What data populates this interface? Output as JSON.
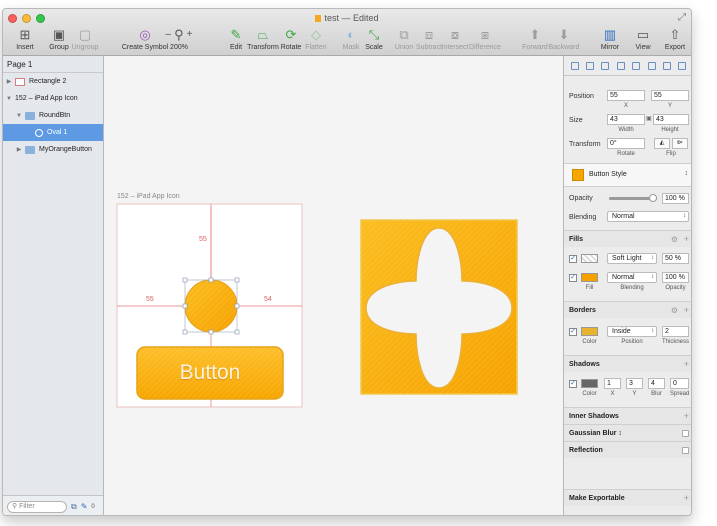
{
  "window": {
    "title": "test",
    "title_suffix": "— Edited"
  },
  "toolbar": {
    "items": [
      {
        "label": "Insert",
        "icon": "insert-icon",
        "enabled": true
      },
      {
        "label": "Group",
        "icon": "group-icon",
        "enabled": true
      },
      {
        "label": "Ungroup",
        "icon": "ungroup-icon",
        "enabled": false
      },
      {
        "label": "Create Symbol",
        "icon": "create-symbol-icon",
        "enabled": true
      },
      {
        "label": "200%",
        "icon": "zoom-icon",
        "enabled": true
      },
      {
        "label": "Edit",
        "icon": "edit-icon",
        "enabled": true
      },
      {
        "label": "Transform",
        "icon": "transform-icon",
        "enabled": true
      },
      {
        "label": "Rotate",
        "icon": "rotate-icon",
        "enabled": true
      },
      {
        "label": "Flatten",
        "icon": "flatten-icon",
        "enabled": false
      },
      {
        "label": "Mask",
        "icon": "mask-icon",
        "enabled": false
      },
      {
        "label": "Scale",
        "icon": "scale-icon",
        "enabled": true
      },
      {
        "label": "Union",
        "icon": "union-icon",
        "enabled": false
      },
      {
        "label": "Subtract",
        "icon": "subtract-icon",
        "enabled": false
      },
      {
        "label": "Intersect",
        "icon": "intersect-icon",
        "enabled": false
      },
      {
        "label": "Difference",
        "icon": "difference-icon",
        "enabled": false
      },
      {
        "label": "Forward",
        "icon": "forward-icon",
        "enabled": false
      },
      {
        "label": "Backward",
        "icon": "backward-icon",
        "enabled": false
      },
      {
        "label": "Mirror",
        "icon": "mirror-icon",
        "enabled": true
      },
      {
        "label": "View",
        "icon": "view-icon",
        "enabled": true
      },
      {
        "label": "Export",
        "icon": "export-icon",
        "enabled": true
      }
    ],
    "zoom_minus": "–",
    "zoom_plus": "+"
  },
  "layers": {
    "page": "Page 1",
    "items": [
      {
        "label": "Rectangle 2",
        "type": "rectangle",
        "depth": 0,
        "expanded": false,
        "selected": false
      },
      {
        "label": "152 – iPad App Icon",
        "type": "artboard",
        "depth": 0,
        "expanded": true,
        "selected": false
      },
      {
        "label": "RoundBtn",
        "type": "folder",
        "depth": 1,
        "expanded": true,
        "selected": false
      },
      {
        "label": "Oval 1",
        "type": "oval",
        "depth": 2,
        "expanded": false,
        "selected": true
      },
      {
        "label": "MyOrangeButton",
        "type": "folder",
        "depth": 1,
        "expanded": false,
        "selected": false
      }
    ],
    "filter_placeholder": "Filter",
    "filter_count": "0"
  },
  "canvas": {
    "artboard_label": "152 – iPad App Icon",
    "measure_top": "55",
    "measure_left": "55",
    "measure_right": "54",
    "button_text": "Button"
  },
  "inspector": {
    "position_label": "Position",
    "position_x": "55",
    "position_y": "55",
    "x_label": "X",
    "y_label": "Y",
    "size_label": "Size",
    "width": "43",
    "height": "43",
    "width_label": "Width",
    "height_label": "Height",
    "transform_label": "Transform",
    "rotate_value": "0°",
    "rotate_label": "Rotate",
    "flip_label": "Flip",
    "style_name": "Button Style",
    "opacity_label": "Opacity",
    "opacity_value": "100 %",
    "opacity_fraction": 1.0,
    "blending_label": "Blending",
    "blending_value": "Normal",
    "fills_title": "Fills",
    "fills": [
      {
        "blend": "Soft Light",
        "opacity": "50 %"
      },
      {
        "blend": "Normal",
        "opacity": "100 %"
      }
    ],
    "fill_label": "Fill",
    "fill_blending_label": "Blending",
    "fill_opacity_label": "Opacity",
    "borders_title": "Borders",
    "border_position": "Inside",
    "border_thickness": "2",
    "border_color_label": "Color",
    "border_position_label": "Position",
    "border_thickness_label": "Thickness",
    "shadows_title": "Shadows",
    "shadow_x": "1",
    "shadow_y": "3",
    "shadow_blur": "4",
    "shadow_spread": "0",
    "shadow_color_label": "Color",
    "shadow_x_label": "X",
    "shadow_y_label": "Y",
    "shadow_blur_label": "Blur",
    "shadow_spread_label": "Spread",
    "inner_shadows_title": "Inner Shadows",
    "gaussian_blur_title": "Gaussian Blur",
    "reflection_title": "Reflection",
    "make_exportable_title": "Make Exportable"
  },
  "colors": {
    "orange": "#f7a600",
    "orange_light": "#fccb3a",
    "guide_red": "#e27474",
    "selection_blue": "#5d9ae3"
  }
}
